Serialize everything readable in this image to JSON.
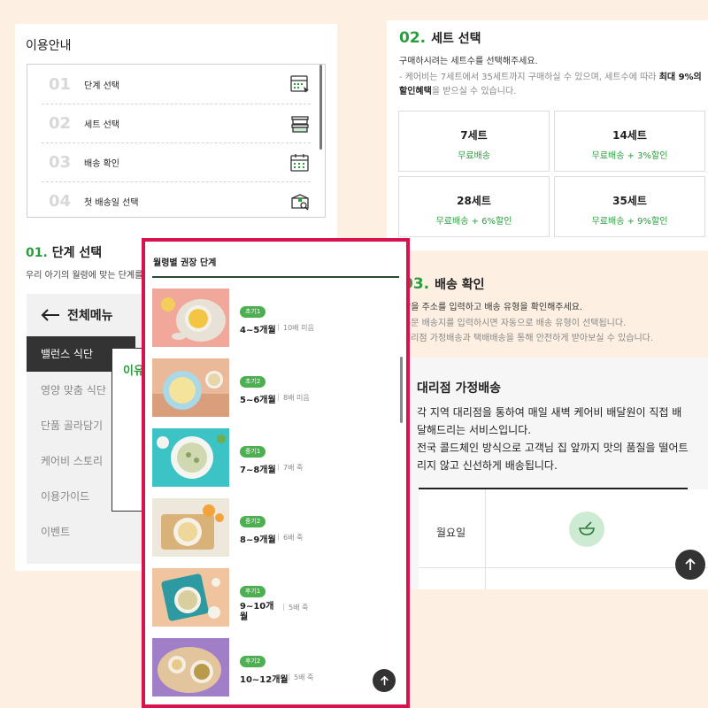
{
  "left_panel": {
    "title": "이용안내",
    "steps": [
      {
        "num": "01",
        "label": "단계 선택",
        "icon": "calendar-select-icon"
      },
      {
        "num": "02",
        "label": "세트 선택",
        "icon": "container-stack-icon"
      },
      {
        "num": "03",
        "label": "배송 확인",
        "icon": "calendar-icon"
      },
      {
        "num": "04",
        "label": "첫 배송일 선택",
        "icon": "box-search-icon"
      }
    ],
    "section_num": "01",
    "section_title": "단계 선택",
    "section_desc": "우리 아기의 월령에 맞는 단계를"
  },
  "menu": {
    "back_label": "전체메뉴",
    "items": [
      "밸런스 식단",
      "영양 맞춤 식단",
      "단품 골라담기",
      "케어비 스토리",
      "이용가이드",
      "이벤트"
    ],
    "active_index": 0,
    "popup_label": "이유"
  },
  "set_select": {
    "num": "02",
    "title": "세트 선택",
    "desc": "구매하시려는 세트수를 선택해주세요.",
    "note_prefix": "- 케어비는 7세트에서 35세트까지 구매하실 수 있으며, 세트수에 따라 ",
    "note_bold": "최대 9%의 할인혜택",
    "note_suffix": "을 받으실 수 있습니다.",
    "sets": [
      {
        "name": "7세트",
        "benefit": "무료배송"
      },
      {
        "name": "14세트",
        "benefit": "무료배송 + 3%할인"
      },
      {
        "name": "28세트",
        "benefit": "무료배송 + 6%할인"
      },
      {
        "name": "35세트",
        "benefit": "무료배송 + 9%할인"
      }
    ]
  },
  "delivery": {
    "num": "03",
    "title": "배송 확인",
    "desc": "받을 주소를 입력하고 배송 유형을 확인해주세요.",
    "note1": "주문 배송지를 입력하시면 자동으로 배송 유형이 선택됩니다.",
    "note2": "대리점 가정배송과 택배배송을 통해 안전하게 받아보실 수 있습니다.",
    "card_title": "대리점 가정배송",
    "card_text": "각 지역 대리점을 통하여 매일 새벽 케어비 배달원이 직접 배달해드리는 서비스입니다.",
    "card_text2": "전국 콜드체인 방식으로 고객님 집 앞까지 맛의 품질을 떨어트리지 않고 신선하게 배송됩니다.",
    "table_day": "월요일"
  },
  "popup": {
    "title": "월령별 권장 단계",
    "rows": [
      {
        "badge": "초기1",
        "age": "4~5개월",
        "note": "10배 미음"
      },
      {
        "badge": "초기2",
        "age": "5~6개월",
        "note": "8배 미음"
      },
      {
        "badge": "중기1",
        "age": "7~8개월",
        "note": "7배 죽"
      },
      {
        "badge": "중기2",
        "age": "8~9개월",
        "note": "6배 죽"
      },
      {
        "badge": "후기1",
        "age": "9~10개월",
        "note": "5배 죽"
      },
      {
        "badge": "후기2",
        "age": "10~12개월",
        "note": "5배 죽"
      }
    ]
  },
  "colors": {
    "accent": "#2a9d3f",
    "highlight_border": "#d8124f",
    "badge": "#4caf50",
    "dark": "#333333"
  }
}
